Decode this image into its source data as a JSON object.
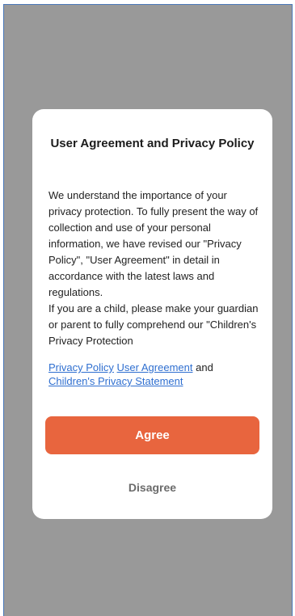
{
  "dialog": {
    "title": "User Agreement and Privacy Policy",
    "body": [
      "We understand the importance of your privacy protection. To fully present the way of collection and use of your personal information, we have revised our \"Privacy Policy\", \"User Agreement\" in detail in accordance with the latest laws and regulations.",
      "If you are a child, please make your guardian or parent to fully comprehend our \"Children's Privacy Protection"
    ],
    "links": {
      "privacy_policy": "Privacy Policy",
      "user_agreement": "User Agreement",
      "and_text": "and",
      "childrens_statement": "Children's Privacy Statement"
    },
    "agree_label": "Agree",
    "disagree_label": "Disagree"
  },
  "colors": {
    "overlay": "#999999",
    "agree_button": "#e8653e",
    "link": "#2f6fd0"
  }
}
